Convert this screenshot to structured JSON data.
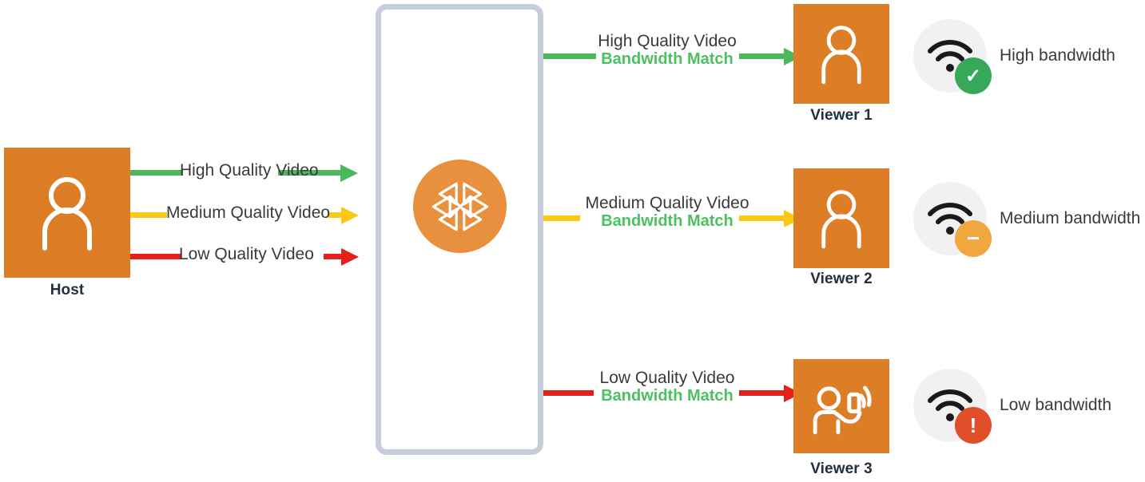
{
  "diagram": {
    "title": "Adaptive bitrate video delivery with bandwidth matching",
    "colors": {
      "orange_tile": "#DD7E27",
      "ivs_circle": "#E8903E",
      "container_border": "#C5CEDA",
      "high": "#4CB85C",
      "medium": "#FBC914",
      "low": "#E3211A",
      "match_text": "#4CC15F",
      "label_text": "#3A3A3A",
      "node_label_text": "#232F3E",
      "badge_bg": "#F1F1F1",
      "badge_ok": "#37A85A",
      "badge_warn": "#F0A73E",
      "badge_alert": "#E04E2A"
    },
    "source": {
      "label": "Host",
      "icon": "person-icon"
    },
    "service": {
      "icon": "aws-ivs-icon",
      "container_icon": "rounded-container"
    },
    "ingest_streams": [
      {
        "label": "High Quality Video",
        "color": "#4CB85C",
        "quality": "high"
      },
      {
        "label": "Medium Quality Video",
        "color": "#FBC914",
        "quality": "medium"
      },
      {
        "label": "Low Quality Video",
        "color": "#E3211A",
        "quality": "low"
      }
    ],
    "egress_streams": [
      {
        "line1": "High Quality Video",
        "line2": "Bandwidth Match",
        "color": "#4CB85C",
        "viewer_label": "Viewer 1",
        "viewer_icon": "person-icon",
        "bandwidth_text": "High bandwidth",
        "bandwidth_icon": "wifi-icon",
        "badge_icon": "check-icon",
        "badge_glyph": "✓",
        "badge_color": "#37A85A"
      },
      {
        "line1": "Medium Quality Video",
        "line2": "Bandwidth Match",
        "color": "#FBC914",
        "viewer_label": "Viewer 2",
        "viewer_icon": "person-icon",
        "bandwidth_text": "Medium bandwidth",
        "bandwidth_icon": "wifi-icon",
        "badge_icon": "minus-icon",
        "badge_glyph": "−",
        "badge_color": "#F0A73E"
      },
      {
        "line1": "Low Quality Video",
        "line2": "Bandwidth Match",
        "color": "#E3211A",
        "viewer_label": "Viewer 3",
        "viewer_icon": "person-mobile-icon",
        "bandwidth_text": "Low bandwidth",
        "bandwidth_icon": "wifi-icon",
        "badge_icon": "exclamation-icon",
        "badge_glyph": "!",
        "badge_color": "#E04E2A"
      }
    ]
  }
}
